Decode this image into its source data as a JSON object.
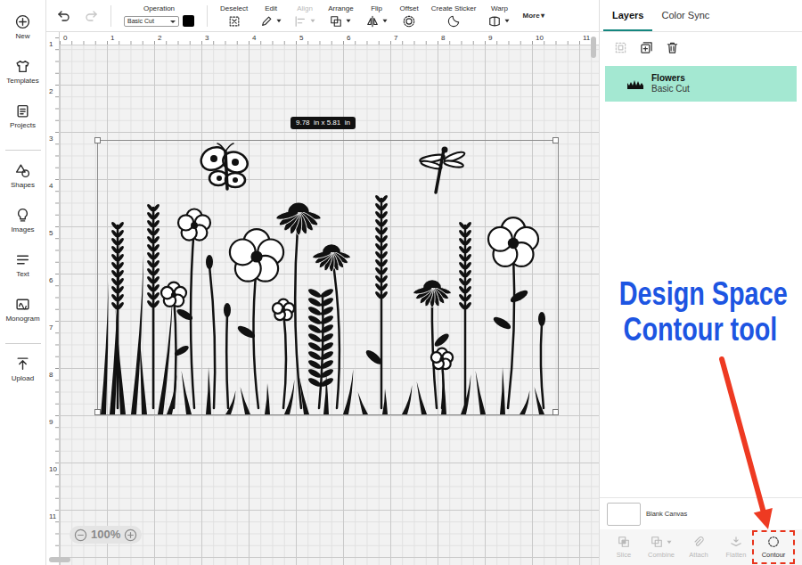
{
  "sidebar": {
    "items": [
      {
        "label": "New"
      },
      {
        "label": "Templates"
      },
      {
        "label": "Projects"
      },
      {
        "label": "Shapes"
      },
      {
        "label": "Images"
      },
      {
        "label": "Text"
      },
      {
        "label": "Monogram"
      },
      {
        "label": "Upload"
      }
    ]
  },
  "toolbar": {
    "undo": {
      "disabled": false
    },
    "redo": {
      "disabled": true
    },
    "operation": {
      "label": "Operation",
      "value": "Basic Cut",
      "color": "#000000"
    },
    "tools": [
      {
        "label": "Deselect",
        "kind": "button",
        "disabled": false
      },
      {
        "label": "Edit",
        "kind": "dropdown",
        "disabled": false
      },
      {
        "label": "Align",
        "kind": "dropdown",
        "disabled": true
      },
      {
        "label": "Arrange",
        "kind": "dropdown",
        "disabled": false
      },
      {
        "label": "Flip",
        "kind": "dropdown",
        "disabled": false
      },
      {
        "label": "Offset",
        "kind": "button",
        "disabled": false
      },
      {
        "label": "Create Sticker",
        "kind": "button",
        "disabled": false
      },
      {
        "label": "Warp",
        "kind": "dropdown",
        "disabled": false
      }
    ],
    "more": {
      "label": "More",
      "caret": "▾"
    }
  },
  "rulers": {
    "top": [
      "0",
      "1",
      "2",
      "3",
      "4",
      "5",
      "6",
      "7",
      "8",
      "9",
      "10",
      "11"
    ],
    "left": [
      "1",
      "2",
      "3",
      "4",
      "5",
      "6",
      "7",
      "8",
      "9",
      "10",
      "11"
    ]
  },
  "canvas": {
    "selection_size": "9.78  in x 5.81  in"
  },
  "zoom": {
    "level": "100%"
  },
  "panel": {
    "tabs": [
      {
        "label": "Layers",
        "selected": true
      },
      {
        "label": "Color Sync",
        "selected": false
      }
    ],
    "actions": [
      {
        "disabled": true
      },
      {
        "disabled": false
      },
      {
        "disabled": false
      }
    ],
    "layers": [
      {
        "name": "Flowers",
        "operation": "Basic Cut",
        "selected": true
      }
    ],
    "canvas_layer": {
      "label": "Blank Canvas"
    },
    "tools": [
      {
        "label": "Slice",
        "disabled": true,
        "highlighted": false
      },
      {
        "label": "Combine",
        "disabled": true,
        "highlighted": false
      },
      {
        "label": "Attach",
        "disabled": true,
        "highlighted": false
      },
      {
        "label": "Flatten",
        "disabled": true,
        "highlighted": false
      },
      {
        "label": "Contour",
        "disabled": false,
        "highlighted": true
      }
    ]
  },
  "annotation": {
    "lines": [
      "Design Space",
      "Contour tool"
    ]
  }
}
